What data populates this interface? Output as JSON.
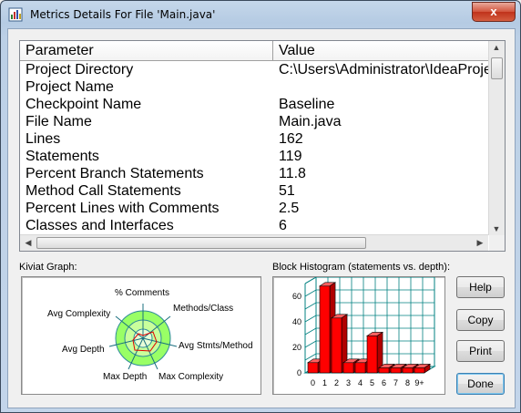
{
  "window": {
    "title": "Metrics Details For File 'Main.java'",
    "close_glyph": "x"
  },
  "table": {
    "headers": [
      "Parameter",
      "Value"
    ],
    "rows": [
      [
        "Project Directory",
        "C:\\Users\\Administrator\\IdeaProjects"
      ],
      [
        "Project Name",
        ""
      ],
      [
        "Checkpoint Name",
        "Baseline"
      ],
      [
        "File Name",
        "Main.java"
      ],
      [
        "Lines",
        "162"
      ],
      [
        "Statements",
        "119"
      ],
      [
        "Percent Branch Statements",
        "11.8"
      ],
      [
        "Method Call Statements",
        "51"
      ],
      [
        "Percent Lines with Comments",
        "2.5"
      ],
      [
        "Classes and Interfaces",
        "6"
      ]
    ]
  },
  "kiviat": {
    "label": "Kiviat Graph:",
    "axes": [
      "% Comments",
      "Methods/Class",
      "Avg Stmts/Method",
      "Max Complexity",
      "Max Depth",
      "Avg Depth",
      "Avg Complexity"
    ]
  },
  "histogram": {
    "label": "Block Histogram (statements vs. depth):"
  },
  "buttons": {
    "help": "Help",
    "copy": "Copy",
    "print": "Print",
    "done": "Done"
  },
  "colors": {
    "bar": "#ff0000",
    "kiviat_fill": "#99ff66",
    "grid": "#008080"
  },
  "chart_data": {
    "type": "bar",
    "categories": [
      "0",
      "1",
      "2",
      "3",
      "4",
      "5",
      "6",
      "7",
      "8",
      "9+"
    ],
    "values": [
      8,
      68,
      43,
      8,
      8,
      29,
      4,
      4,
      4,
      4
    ],
    "xlabel": "",
    "ylabel": "",
    "ylim": [
      0,
      70
    ],
    "yticks": [
      "0",
      "20",
      "40",
      "60"
    ],
    "grid": true,
    "style": "3d"
  }
}
